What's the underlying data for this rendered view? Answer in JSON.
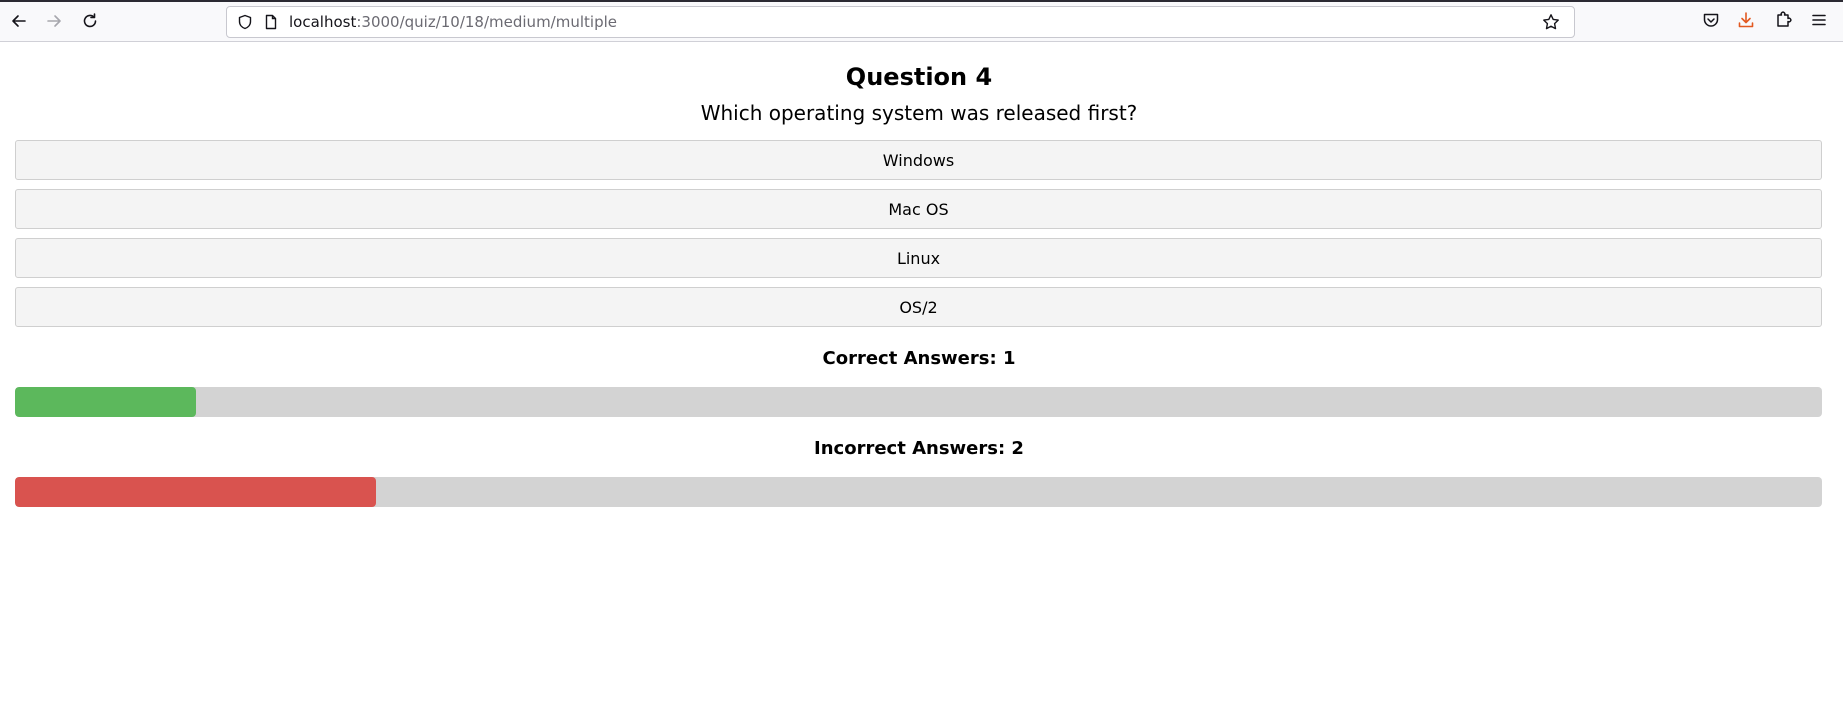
{
  "browser": {
    "url_host": "localhost",
    "url_path": ":3000/quiz/10/18/medium/multiple"
  },
  "quiz": {
    "question_title": "Question 4",
    "question_text": "Which operating system was released first?",
    "answers": [
      "Windows",
      "Mac OS",
      "Linux",
      "OS/2"
    ]
  },
  "stats": {
    "correct_label": "Correct Answers: 1",
    "incorrect_label": "Incorrect Answers: 2",
    "correct_progress": 0.1,
    "incorrect_progress": 0.2,
    "correct_color": "#5cb85c",
    "incorrect_color": "#d9534f"
  }
}
